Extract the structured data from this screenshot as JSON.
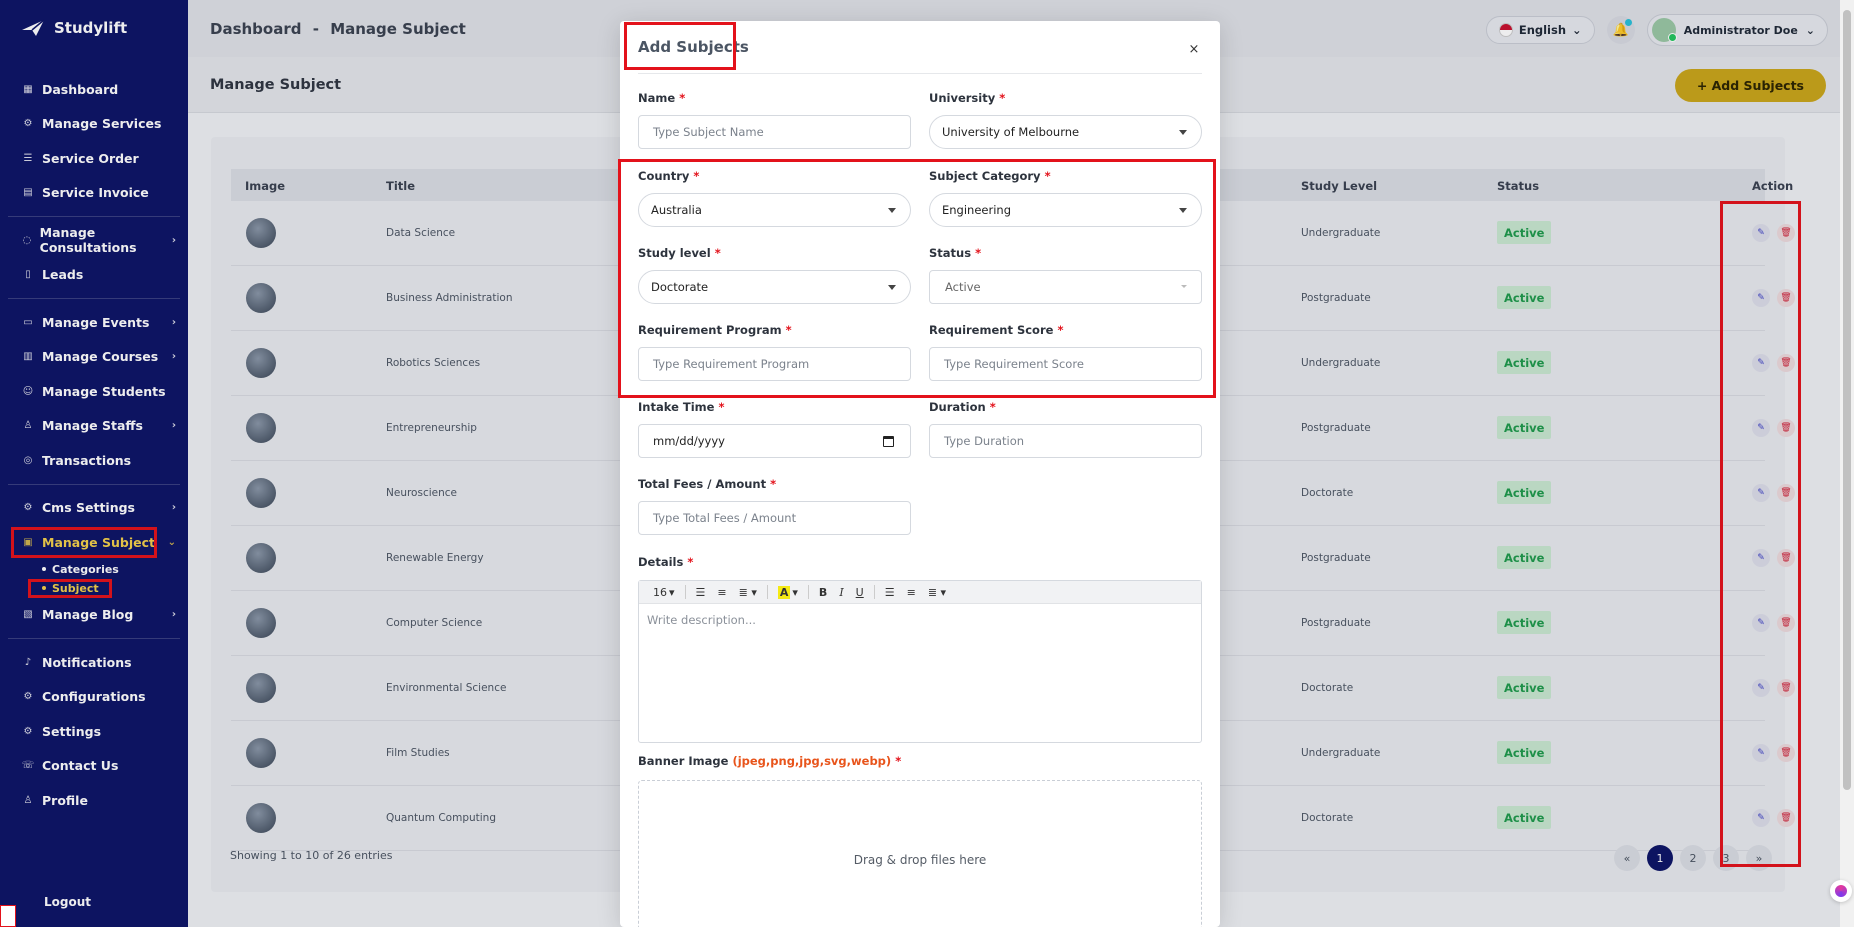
{
  "app": {
    "name": "Studylift"
  },
  "sidebar": {
    "groups": [
      [
        {
          "label": "Dashboard",
          "icon": "grid-icon",
          "chevron": false
        },
        {
          "label": "Manage Services",
          "icon": "gear-icon",
          "chevron": false
        },
        {
          "label": "Service Order",
          "icon": "list-icon",
          "chevron": false
        },
        {
          "label": "Service Invoice",
          "icon": "invoice-icon",
          "chevron": false
        }
      ],
      [
        {
          "label": "Manage Consultations",
          "icon": "chat-icon",
          "chevron": true
        },
        {
          "label": "Leads",
          "icon": "clipboard-icon",
          "chevron": false
        }
      ],
      [
        {
          "label": "Manage Events",
          "icon": "calendar-icon",
          "chevron": true
        },
        {
          "label": "Manage Courses",
          "icon": "book-icon",
          "chevron": true
        },
        {
          "label": "Manage Students",
          "icon": "users-icon",
          "chevron": false
        },
        {
          "label": "Manage Staffs",
          "icon": "staff-icon",
          "chevron": true
        },
        {
          "label": "Transactions",
          "icon": "coin-icon",
          "chevron": false
        }
      ],
      [
        {
          "label": "Cms Settings",
          "icon": "cms-icon",
          "chevron": true
        },
        {
          "label": "Manage Subject",
          "icon": "subject-icon",
          "chevron": true,
          "active": true
        }
      ]
    ],
    "subject_sub": [
      {
        "label": "Categories",
        "active": false
      },
      {
        "label": "Subject",
        "active": true
      }
    ],
    "after_sub": [
      {
        "label": "Manage Blog",
        "icon": "blog-icon",
        "chevron": true
      }
    ],
    "bottom": [
      {
        "label": "Notifications",
        "icon": "bell-icon",
        "chevron": false
      },
      {
        "label": "Configurations",
        "icon": "config-icon",
        "chevron": false
      },
      {
        "label": "Settings",
        "icon": "gear-icon",
        "chevron": false
      },
      {
        "label": "Contact Us",
        "icon": "phone-icon",
        "chevron": false
      },
      {
        "label": "Profile",
        "icon": "user-icon",
        "chevron": false
      }
    ],
    "logout": "Logout"
  },
  "header": {
    "crumb_root": "Dashboard",
    "crumb_sep": "-",
    "crumb_current": "Manage Subject",
    "language": "English",
    "user_name": "Administrator Doe"
  },
  "page": {
    "title": "Manage Subject",
    "add_button": "+ Add Subjects"
  },
  "table": {
    "columns": {
      "image": "Image",
      "title": "Title",
      "study_level": "Study Level",
      "status": "Status",
      "action": "Action"
    },
    "rows": [
      {
        "title": "Data Science",
        "level": "Undergraduate",
        "status": "Active"
      },
      {
        "title": "Business Administration",
        "level": "Postgraduate",
        "status": "Active"
      },
      {
        "title": "Robotics Sciences",
        "level": "Undergraduate",
        "status": "Active"
      },
      {
        "title": "Entrepreneurship",
        "level": "Postgraduate",
        "status": "Active"
      },
      {
        "title": "Neuroscience",
        "level": "Doctorate",
        "status": "Active"
      },
      {
        "title": "Renewable Energy",
        "level": "Postgraduate",
        "status": "Active"
      },
      {
        "title": "Computer Science",
        "level": "Postgraduate",
        "status": "Active"
      },
      {
        "title": "Environmental Science",
        "level": "Doctorate",
        "status": "Active"
      },
      {
        "title": "Film Studies",
        "level": "Undergraduate",
        "status": "Active"
      },
      {
        "title": "Quantum Computing",
        "level": "Doctorate",
        "status": "Active"
      }
    ],
    "showing": "Showing 1 to 10 of 26 entries",
    "pages": [
      "«",
      "1",
      "2",
      "3",
      "»"
    ],
    "current_page": "1"
  },
  "modal": {
    "title": "Add Subjects",
    "close": "×",
    "fields": {
      "name": {
        "label": "Name",
        "placeholder": "Type Subject Name"
      },
      "university": {
        "label": "University",
        "value": "University of Melbourne"
      },
      "country": {
        "label": "Country",
        "value": "Australia"
      },
      "category": {
        "label": "Subject Category",
        "value": "Engineering"
      },
      "study_level": {
        "label": "Study level",
        "value": "Doctorate"
      },
      "status": {
        "label": "Status",
        "value": "Active"
      },
      "req_program": {
        "label": "Requirement Program",
        "placeholder": "Type Requirement Program"
      },
      "req_score": {
        "label": "Requirement Score",
        "placeholder": "Type Requirement Score"
      },
      "intake": {
        "label": "Intake Time",
        "value": "mm/dd/yyyy"
      },
      "duration": {
        "label": "Duration",
        "placeholder": "Type Duration"
      },
      "fees": {
        "label": "Total Fees / Amount",
        "placeholder": "Type Total Fees / Amount"
      },
      "details": {
        "label": "Details",
        "placeholder": "Write description...",
        "font_size": "16"
      },
      "banner": {
        "label": "Banner Image",
        "formats": "(jpeg,png,jpg,svg,webp)",
        "dropzone": "Drag & drop files here"
      }
    },
    "required_mark": "*"
  },
  "colors": {
    "sidebar": "#0d1466",
    "accent": "#f3d04a",
    "highlight": "#e3121b",
    "active_badge": "#1e9a4b"
  }
}
